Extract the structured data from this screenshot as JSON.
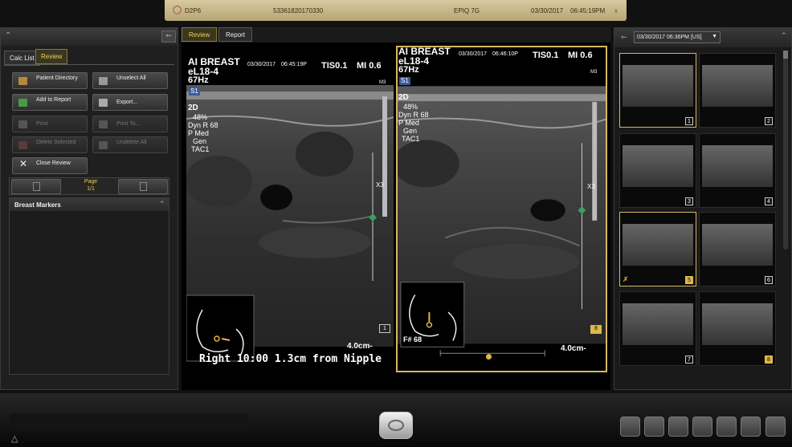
{
  "topbar": {
    "patient_id": "D2P6",
    "accession": "53361820170330",
    "system": "EPIQ 7G",
    "date": "03/30/2017",
    "time": "06:45:19PM",
    "close": "x"
  },
  "left_panel": {
    "tabs": [
      {
        "label": "Calc List"
      },
      {
        "label": "Review"
      }
    ],
    "buttons": {
      "patient_directory": "Patient Directory",
      "unselect_all": "Unselect All",
      "add_to_report": "Add to Report",
      "export": "Export...",
      "print": "Print",
      "print_to": "Print To...",
      "delete_selected": "Delete Selected",
      "undelete_all": "Undelete All",
      "close_review": "Close Review"
    },
    "page_label": "Page",
    "page_value": "1/1",
    "section_title": "Breast Markers"
  },
  "center": {
    "tabs": [
      {
        "label": "Review"
      },
      {
        "label": "Report"
      }
    ],
    "left_image": {
      "preset": "AI BREAST",
      "date": "03/30/2017",
      "time": "06:45:19P",
      "tis": "TIS0.1",
      "mi": "MI 0.6",
      "probe": "eL18-4",
      "freq": "67Hz",
      "mode": "2D",
      "gain": "48%",
      "dyn": "Dyn R 68",
      "pwr": "P Med",
      "gen": "Gen",
      "tac": "TAC1",
      "depth": "4.0cm-",
      "marker": "X3",
      "frame_no": "1",
      "caption": "Right 10:00 1.3cm from Nipple",
      "m3": "M3",
      "s1": "S1"
    },
    "right_image": {
      "preset": "AI BREAST",
      "date": "03/30/2017",
      "time": "06:46:10P",
      "tis": "TIS0.1",
      "mi": "MI 0.6",
      "probe": "eL18-4",
      "freq": "67Hz",
      "mode": "2D",
      "gain": "48%",
      "dyn": "Dyn R 68",
      "pwr": "P Med",
      "gen": "Gen",
      "tac": "TAC1",
      "depth": "4.0cm-",
      "marker": "X3",
      "frame_label": "F# 68",
      "frame_no": "8",
      "m3": "M3",
      "s1": "S1",
      "cine_position": 0.45
    }
  },
  "right_panel": {
    "exam_date": "03/30/2017 06:36PM [US]",
    "thumbnails": [
      "1",
      "2",
      "3",
      "4",
      "5",
      "6",
      "7",
      "8"
    ]
  },
  "colors": {
    "accent": "#e0b74c",
    "panel_bg": "#1f1f1f",
    "selected_border": "#d7b764"
  }
}
